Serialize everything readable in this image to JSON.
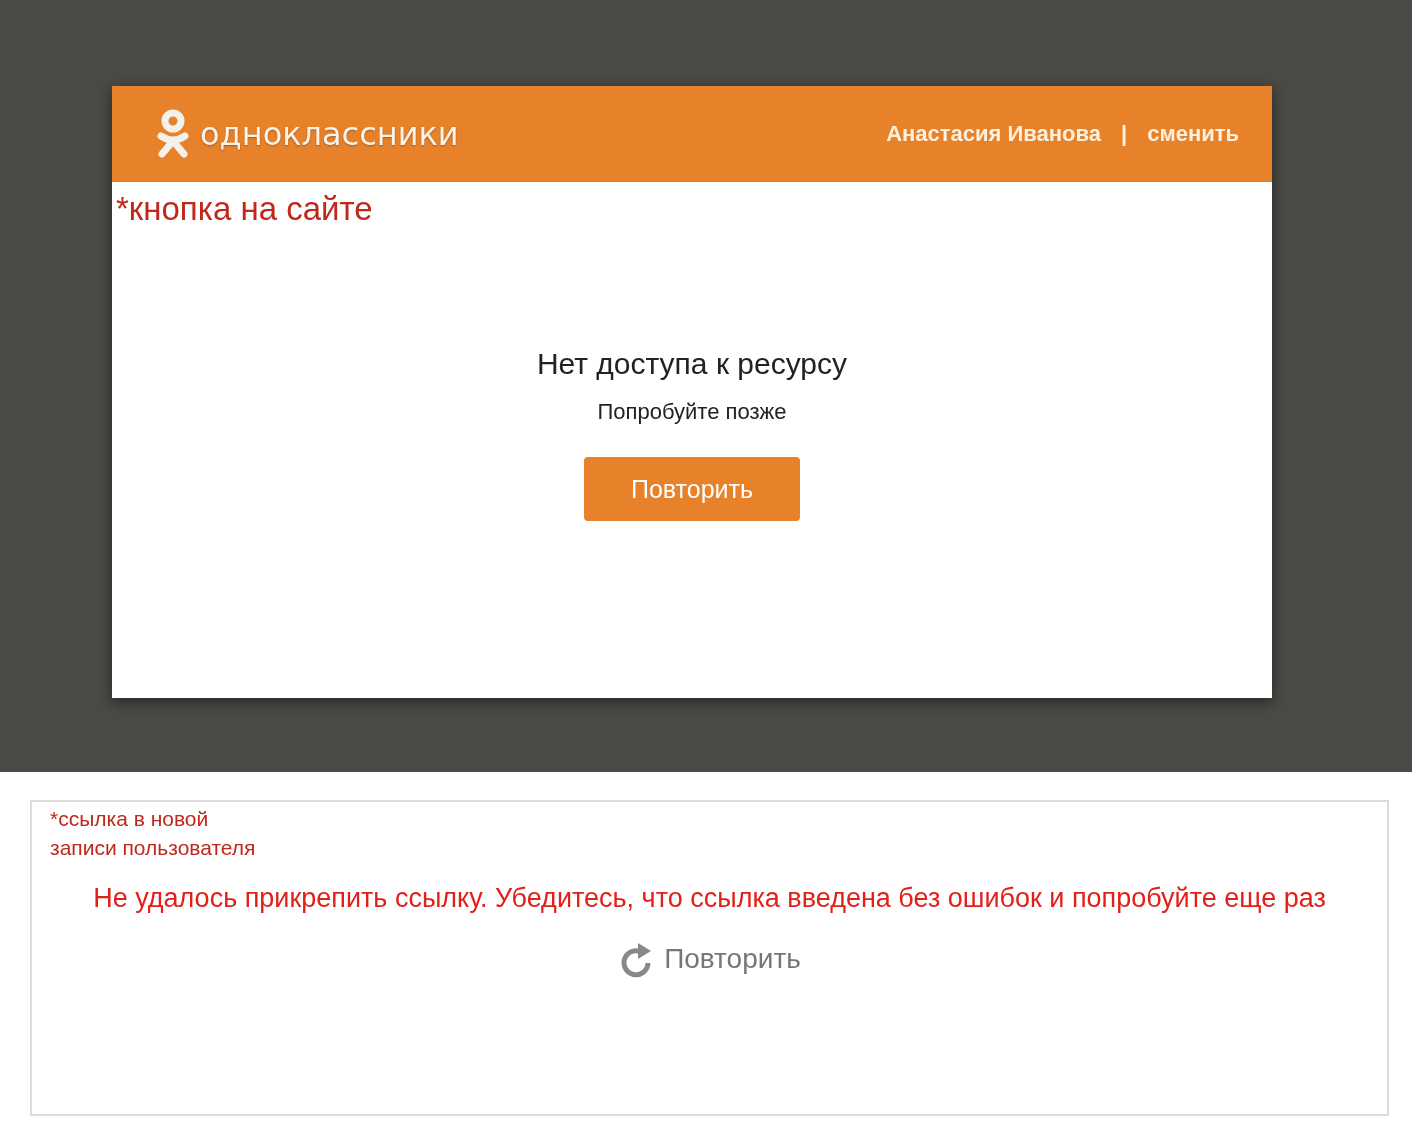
{
  "site_screen": {
    "logo_text": "одноклассники",
    "user_name": "Анастасия Иванова",
    "separator": "|",
    "switch_link": "сменить",
    "annotation": "*кнопка на сайте",
    "error_title": "Нет доступа к ресурсу",
    "error_hint": "Попробуйте позже",
    "retry_button": "Повторить"
  },
  "post_screen": {
    "annotation": "*ссылка в новой записи пользователя",
    "error_message": "Не удалось прикрепить ссылку. Убедитесь, что ссылка введена без ошибок и попробуйте еще раз",
    "retry_link": "Повторить"
  }
}
